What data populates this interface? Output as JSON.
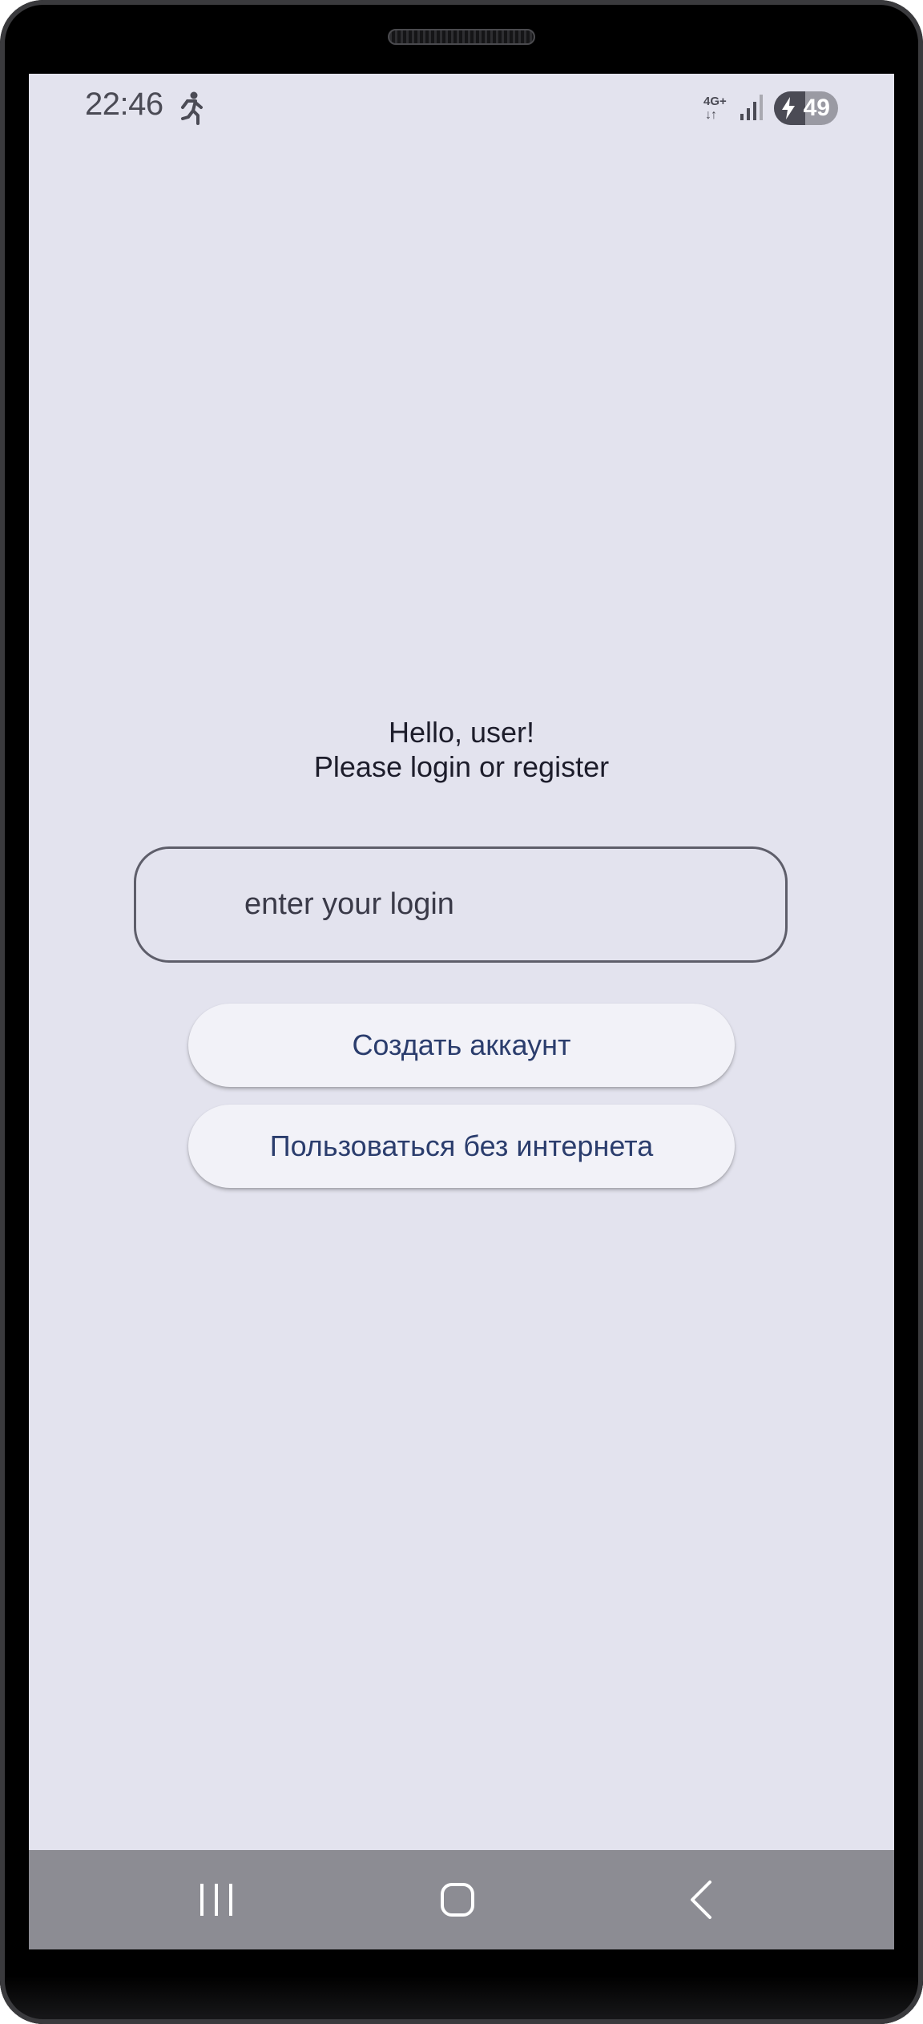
{
  "status_bar": {
    "time": "22:46",
    "activity_icon": "running-person-icon",
    "network_type": "4G+",
    "network_arrows": "↓↑",
    "signal_icon": "signal-bars-icon",
    "battery_level": "49",
    "battery_fraction": 0.49,
    "battery_charging": true
  },
  "greeting": {
    "line1": "Hello, user!",
    "line2": "Please login or register"
  },
  "login_field": {
    "value": "",
    "placeholder": "enter your login"
  },
  "buttons": {
    "create_account": "Создать аккаунт",
    "offline": "Пользоваться без интернета"
  },
  "nav_bar": {
    "recents_icon": "recents-icon",
    "home_icon": "home-icon",
    "back_icon": "back-icon"
  },
  "colors": {
    "screen_background": "#e3e3ee",
    "button_text": "#2b3d6d",
    "button_background": "#f2f2f8",
    "nav_bar": "#8c8c93"
  }
}
